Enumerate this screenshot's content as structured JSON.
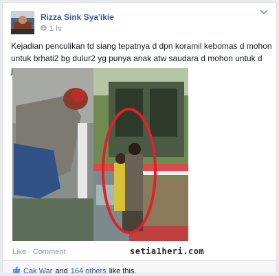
{
  "post": {
    "author": "Rizza Sink Sya'ikie",
    "time": "1 hr",
    "text": "Kejadian penculikan td siang tepatnya d dpn koramil kebomas d mohon untuk brhati2 bg dulur2 yg punya anak atw saudara d mohon untuk d jaga"
  },
  "actions": {
    "like": "Like",
    "separator": "·",
    "comment": "Comment"
  },
  "watermark": "setia1heri.com",
  "likes": {
    "first_name": "Cak War",
    "and": "and",
    "others": "164 others",
    "suffix": "like this."
  },
  "icons": {
    "options": "chevron-down-icon",
    "audience": "globe-icon",
    "like": "thumbs-up-icon"
  },
  "colors": {
    "link": "#3b5998",
    "meta": "#90949c",
    "annotation": "#e0202a"
  }
}
